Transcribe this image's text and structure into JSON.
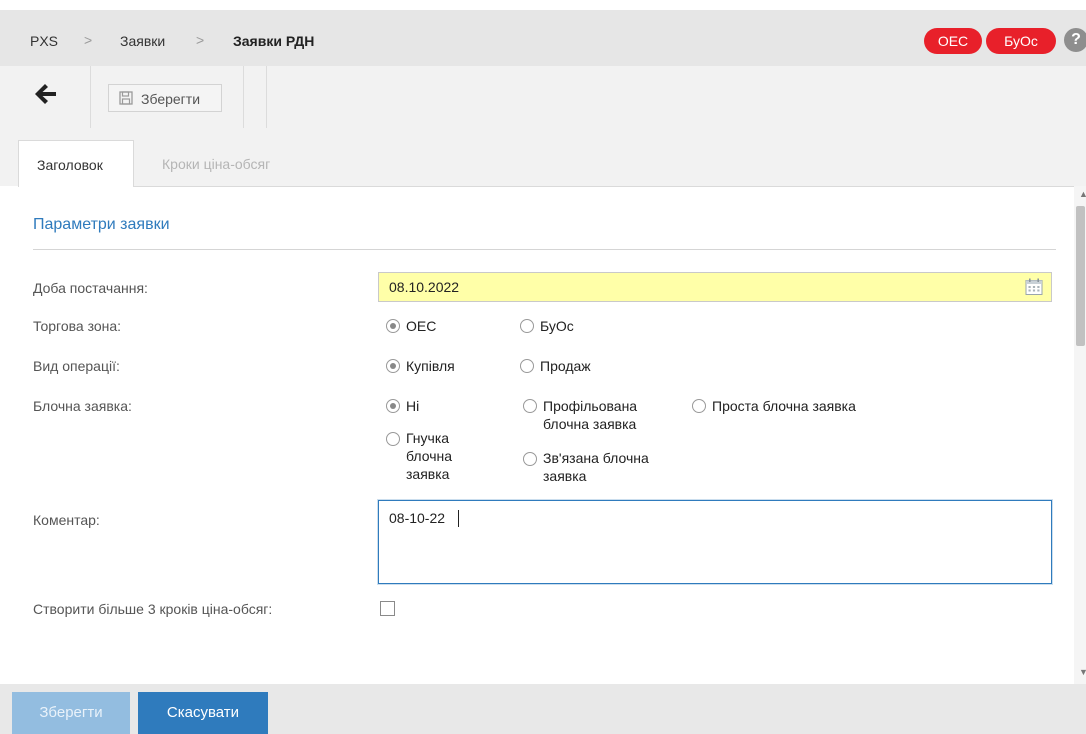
{
  "breadcrumb": {
    "root": "PXS",
    "sep": ">",
    "section": "Заявки",
    "current": "Заявки РДН"
  },
  "zone_badges": [
    "ОЕС",
    "БуОс"
  ],
  "help": "?",
  "toolbar": {
    "save_label": "Зберегти"
  },
  "tabs": [
    {
      "label": "Заголовок",
      "active": true
    },
    {
      "label": "Кроки ціна-обсяг",
      "active": false
    }
  ],
  "section_title": "Параметри заявки",
  "fields": {
    "delivery_day": {
      "label": "Доба постачання:",
      "value": "08.10.2022"
    },
    "trade_zone": {
      "label": "Торгова зона:",
      "options": [
        "ОЕС",
        "БуОс"
      ],
      "selected": "ОЕС"
    },
    "operation": {
      "label": "Вид операції:",
      "options": [
        "Купівля",
        "Продаж"
      ],
      "selected": "Купівля"
    },
    "block_order": {
      "label": "Блочна заявка:",
      "options": [
        "Ні",
        "Профільована блочна заявка",
        "Проста блочна заявка",
        "Гнучка блочна заявка",
        "Зв'язана блочна заявка"
      ],
      "selected": "Ні",
      "lines": {
        "profiled_1": "Профільована",
        "profiled_2": "блочна заявка",
        "flexible_1": "Гнучка",
        "flexible_2": "блочна",
        "flexible_3": "заявка",
        "linked_1": "Зв'язана блочна",
        "linked_2": "заявка"
      }
    },
    "comment": {
      "label": "Коментар:",
      "value": "08-10-22"
    },
    "more_steps": {
      "label": "Створити більше 3 кроків ціна-обсяг:",
      "checked": false
    }
  },
  "footer": {
    "save_label": "Зберегти",
    "cancel_label": "Скасувати"
  },
  "colors": {
    "accent": "#2f7bbd",
    "badge": "#e8202a",
    "date_bg": "#ffffa8"
  },
  "icons": [
    "back-arrow-icon",
    "save-disk-icon",
    "calendar-icon",
    "help-icon"
  ]
}
